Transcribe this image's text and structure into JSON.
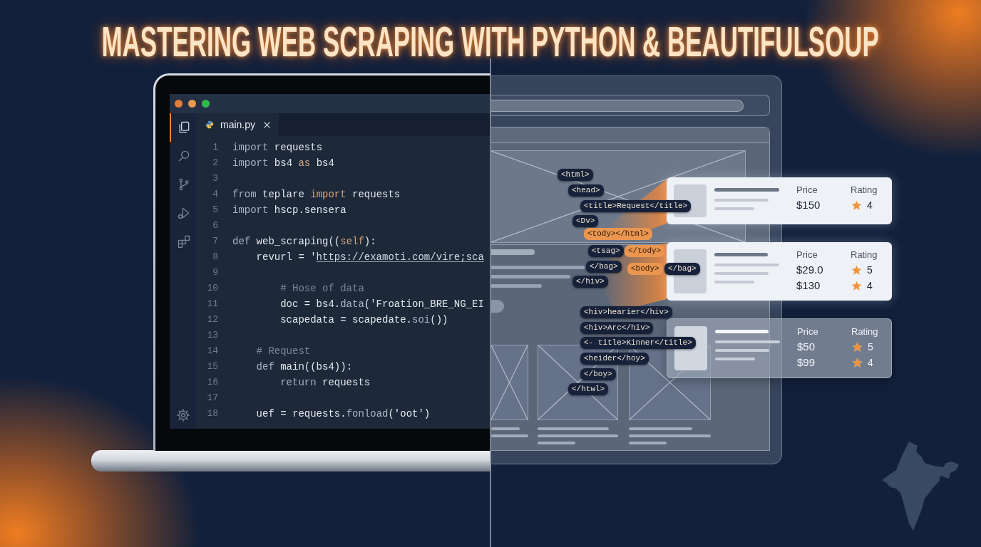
{
  "title": "MASTERING WEB SCRAPING WITH PYTHON & BEAUTIFULSOUP",
  "editor": {
    "activity_bar": [
      {
        "selected": true
      },
      {
        "selected": false
      },
      {
        "selected": false
      },
      {
        "selected": false
      },
      {
        "selected": false
      }
    ],
    "tab": {
      "label": "main.py",
      "selected": true
    },
    "lines": [
      {
        "number": "1",
        "tokens": [
          {
            "kind": "keyword",
            "text": "import"
          },
          {
            "kind": "plain",
            "text": " requests"
          }
        ]
      },
      {
        "number": "2",
        "tokens": [
          {
            "kind": "keyword",
            "text": "import"
          },
          {
            "kind": "plain",
            "text": " bs4 "
          },
          {
            "kind": "accent",
            "text": "as"
          },
          {
            "kind": "plain",
            "text": " bs4"
          }
        ]
      },
      {
        "number": "3"
      },
      {
        "number": "4",
        "tokens": [
          {
            "kind": "keyword",
            "text": "from"
          },
          {
            "kind": "plain",
            "text": " teplare "
          },
          {
            "kind": "accent",
            "text": "import"
          },
          {
            "kind": "plain",
            "text": " requests"
          }
        ]
      },
      {
        "number": "5",
        "tokens": [
          {
            "kind": "keyword",
            "text": "import"
          },
          {
            "kind": "plain",
            "text": " hscp.sensera"
          }
        ]
      },
      {
        "number": "6"
      },
      {
        "number": "7",
        "tokens": [
          {
            "kind": "keyword",
            "text": "def"
          },
          {
            "kind": "plain",
            "text": " web_scraping(("
          },
          {
            "kind": "accent",
            "text": "self"
          },
          {
            "kind": "plain",
            "text": "):"
          }
        ],
        "children": [
          {
            "number": "8",
            "tokens": [
              {
                "kind": "plain",
                "text": "revurl = '"
              },
              {
                "kind": "link",
                "text": "https://examoti.com/vire;sca"
              }
            ],
            "children": [
              {
                "number": "9"
              },
              {
                "number": "10",
                "tokens": [
                  {
                    "kind": "comment",
                    "text": "# Hose of data"
                  }
                ]
              },
              {
                "number": "11",
                "tokens": [
                  {
                    "kind": "plain",
                    "text": "doc = bs4."
                  },
                  {
                    "kind": "keyword",
                    "text": "data"
                  },
                  {
                    "kind": "plain",
                    "text": "('Froation_BRE_NG_EI"
                  }
                ]
              },
              {
                "number": "12",
                "tokens": [
                  {
                    "kind": "plain",
                    "text": "scapedata = scapedate."
                  },
                  {
                    "kind": "keyword",
                    "text": "soi"
                  },
                  {
                    "kind": "plain",
                    "text": "())"
                  }
                ]
              }
            ]
          },
          {
            "number": "13"
          },
          {
            "number": "14",
            "tokens": [
              {
                "kind": "comment",
                "text": "# Request"
              }
            ]
          },
          {
            "number": "15",
            "tokens": [
              {
                "kind": "keyword",
                "text": "def"
              },
              {
                "kind": "plain",
                "text": " main((bs4)):"
              }
            ],
            "children": [
              {
                "number": "16",
                "tokens": [
                  {
                    "kind": "keyword",
                    "text": "return"
                  },
                  {
                    "kind": "plain",
                    "text": " requests"
                  }
                ]
              }
            ]
          },
          {
            "number": "17"
          },
          {
            "number": "18",
            "tokens": [
              {
                "kind": "plain",
                "text": "uef = requests."
              },
              {
                "kind": "keyword",
                "text": "fonload"
              },
              {
                "kind": "plain",
                "text": "('oot')"
              }
            ]
          }
        ]
      }
    ]
  },
  "html_tags": [
    {
      "text": "<html>",
      "highlighted": false
    },
    {
      "text": "<head>",
      "highlighted": false
    },
    {
      "text": "<title>Request</title>",
      "highlighted": false
    },
    {
      "text": "<Dv>",
      "highlighted": false
    },
    {
      "text": "<tody></html>",
      "highlighted": true
    },
    {
      "text": "<tsag>",
      "highlighted": false
    },
    {
      "text": "</tody>",
      "highlighted": true
    },
    {
      "text": "</bag>",
      "highlighted": false
    },
    {
      "text": "<body>",
      "highlighted": true
    },
    {
      "text": "</bag>",
      "highlighted": false
    },
    {
      "text": "</hiv>",
      "highlighted": false
    },
    {
      "text": "<hiv>hearier</hiv>",
      "highlighted": false
    },
    {
      "text": "<hiv>Arc</hiv>",
      "highlighted": false
    },
    {
      "text": "<- title>Kinner</title>",
      "highlighted": false
    },
    {
      "text": "<heider</hoy>",
      "highlighted": false
    },
    {
      "text": "</boy>",
      "highlighted": false
    },
    {
      "text": "</htwl>",
      "highlighted": false
    }
  ],
  "cards": [
    {
      "kind": "light",
      "price_label": "Price",
      "rating_label": "Rating",
      "rows": [
        {
          "price": "$150",
          "rating": "4"
        }
      ]
    },
    {
      "kind": "light",
      "price_label": "Price",
      "rating_label": "Rating",
      "rows": [
        {
          "price": "$29.0",
          "rating": "5"
        },
        {
          "price": "$130",
          "rating": "4"
        }
      ]
    },
    {
      "kind": "glass",
      "price_label": "Price",
      "rating_label": "Rating",
      "rows": [
        {
          "price": "$50",
          "rating": "5"
        },
        {
          "price": "$99",
          "rating": "4"
        }
      ]
    }
  ]
}
